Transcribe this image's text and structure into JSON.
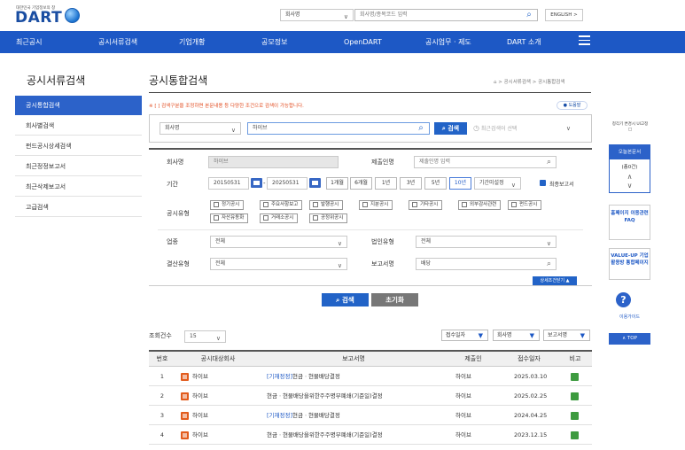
{
  "header": {
    "logo_sub": "대한민국 기업정보의 창",
    "logo": "DART",
    "search_type": "회사명",
    "search_placeholder": "회사명/종목코드 입력",
    "english": "ENGLISH >"
  },
  "nav": {
    "items": [
      "최근공시",
      "공시서류검색",
      "기업개황",
      "공모정보",
      "OpenDART",
      "공시업무 · 제도",
      "DART 소개"
    ]
  },
  "sidebar": {
    "title": "공시서류검색",
    "items": [
      "공시통합검색",
      "회사별검색",
      "펀드공시상세검색",
      "최근정정보고서",
      "최근삭제보고서",
      "고급검색"
    ]
  },
  "main": {
    "title": "공시통합검색",
    "breadcrumb": "> 공시서류검색 > 공시통합검색",
    "notice": "※ [ ] 검색구분을 조정하면 본문내용 등 다양한 조건으로 검색이 가능합니다.",
    "help": "도움말",
    "search": {
      "type": "회사명",
      "value": "하이브",
      "button": "검색",
      "recent_placeholder": "최근검색어 선택"
    }
  },
  "form": {
    "company_label": "회사명",
    "company_value": "하이브",
    "submitter_label": "제출인명",
    "submitter_placeholder": "제출인명 입력",
    "period_label": "기간",
    "date_from": "20150531",
    "date_to": "20250531",
    "period_buttons": [
      "1개월",
      "6개월",
      "1년",
      "3년",
      "5년",
      "10년"
    ],
    "period_active": "10년",
    "period_select": "기간미설정",
    "final_report": "최종보고서",
    "type_label": "공시유형",
    "types": [
      "정기공시",
      "주요사항보고",
      "발행공시",
      "지분공시",
      "기타공시",
      "외부감사관련",
      "펀드공시",
      "자산유동화",
      "거래소공시",
      "공정위공시"
    ],
    "industry_label": "업종",
    "industry_value": "전체",
    "corp_type_label": "법인유형",
    "corp_type_value": "전체",
    "fiscal_label": "결산유형",
    "fiscal_value": "전체",
    "report_label": "보고서명",
    "report_value": "배당",
    "detail_toggle": "상세조건닫기 ▲",
    "search_btn": "검색",
    "reset_btn": "초기화"
  },
  "results": {
    "count_label": "조회건수",
    "count_value": "15",
    "sort1": "접수일자",
    "sort2": "회사명",
    "sort3": "보고서명",
    "headers": [
      "번호",
      "공시대상회사",
      "보고서명",
      "제출인",
      "접수일자",
      "비고"
    ],
    "rows": [
      {
        "no": "1",
        "company": "하이브",
        "tag": "[기재정정]",
        "report": "현금ㆍ현물배당결정",
        "submitter": "하이브",
        "date": "2025.03.10"
      },
      {
        "no": "2",
        "company": "하이브",
        "tag": "",
        "report": "현금ㆍ현물배당을위한주주명부폐쇄(기준일)결정",
        "submitter": "하이브",
        "date": "2025.02.25"
      },
      {
        "no": "3",
        "company": "하이브",
        "tag": "[기재정정]",
        "report": "현금ㆍ현물배당결정",
        "submitter": "하이브",
        "date": "2024.04.25"
      },
      {
        "no": "4",
        "company": "하이브",
        "tag": "",
        "report": "현금ㆍ현물배당을위한주주명부폐쇄(기준일)결정",
        "submitter": "하이브",
        "date": "2023.12.15"
      }
    ]
  },
  "rail": {
    "notice": "청각기 변경시 UI고정",
    "recent_doc": "오늘본문서",
    "recent_count": "(총0건)",
    "homepage": "홈페이지 이용관련 FAQ",
    "valueup": "VALUE-UP 기업활용방 통합페이지",
    "guide": "이용가이드",
    "top": "TOP"
  },
  "colors": {
    "primary": "#1d58c5",
    "notice": "#e24b1f"
  }
}
